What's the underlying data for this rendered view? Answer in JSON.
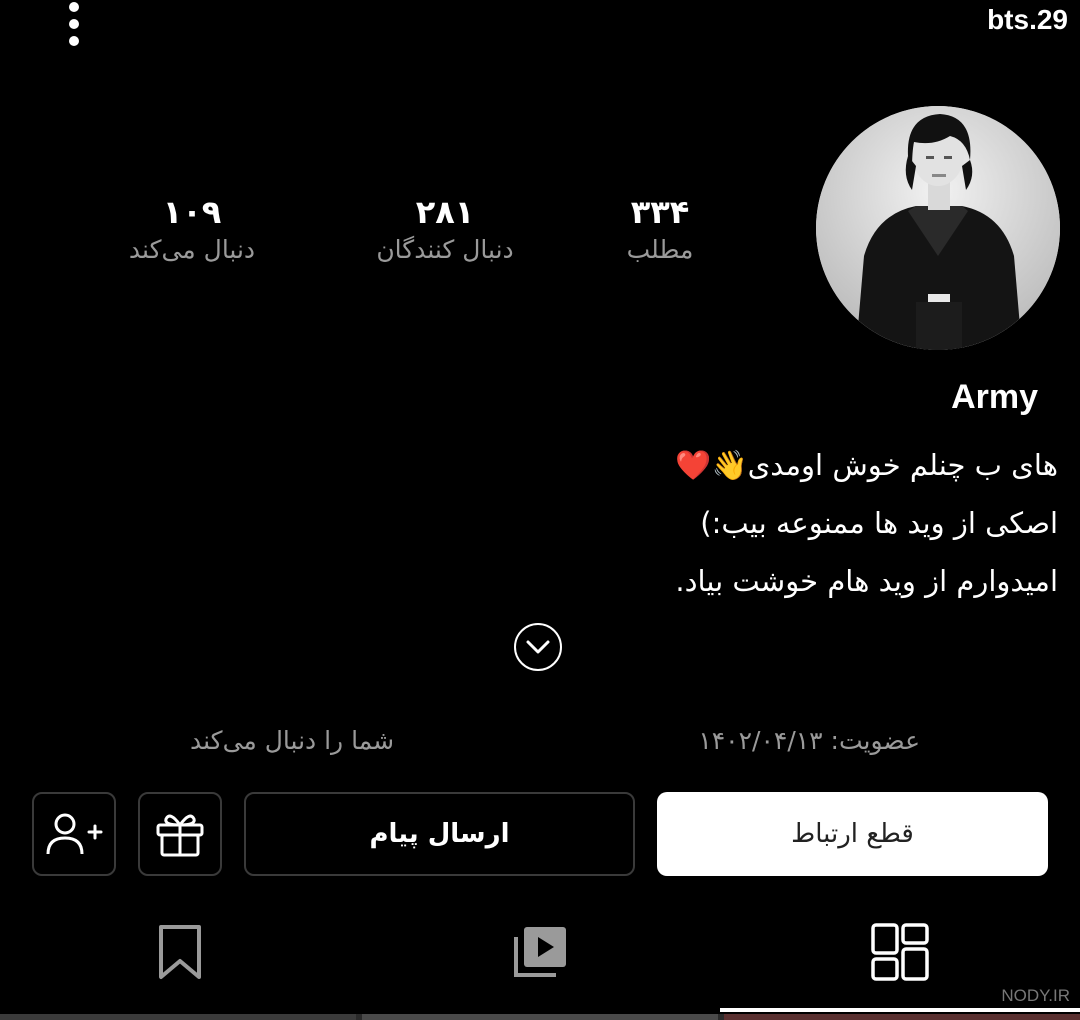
{
  "header": {
    "more_icon": "more-vertical-icon",
    "username": "bts.29"
  },
  "profile": {
    "avatar_icon": "avatar-photo",
    "display_name": "Army",
    "stats": [
      {
        "value": "۳۳۴",
        "label": "مطلب"
      },
      {
        "value": "۲۸۱",
        "label": "دنبال کنندگان"
      },
      {
        "value": "۱۰۹",
        "label": "دنبال می‌کند"
      }
    ],
    "bio": [
      "های ب چنلم خوش اومدی👋❤️",
      "اصکی از وید ها ممنوعه بیب:)",
      "امیدوارم از وید هام خوشت بیاد."
    ],
    "expand_icon": "chevron-down-icon",
    "membership": "عضویت: ۱۴۰۲/۰۴/۱۳",
    "follows_you": "شما را دنبال می‌کند"
  },
  "actions": {
    "disconnect_label": "قطع ارتباط",
    "send_message_label": "ارسال پیام",
    "gift_icon": "gift-icon",
    "add_user_icon": "add-user-icon"
  },
  "tabs": {
    "grid_icon": "grid-icon",
    "video_icon": "video-library-icon",
    "saved_icon": "bookmark-icon",
    "active": "grid"
  },
  "watermark": "NODY.IR",
  "colors": {
    "background": "#000000",
    "text": "#ffffff",
    "muted": "#9a9a9a",
    "button_border": "#3a3a3a"
  }
}
